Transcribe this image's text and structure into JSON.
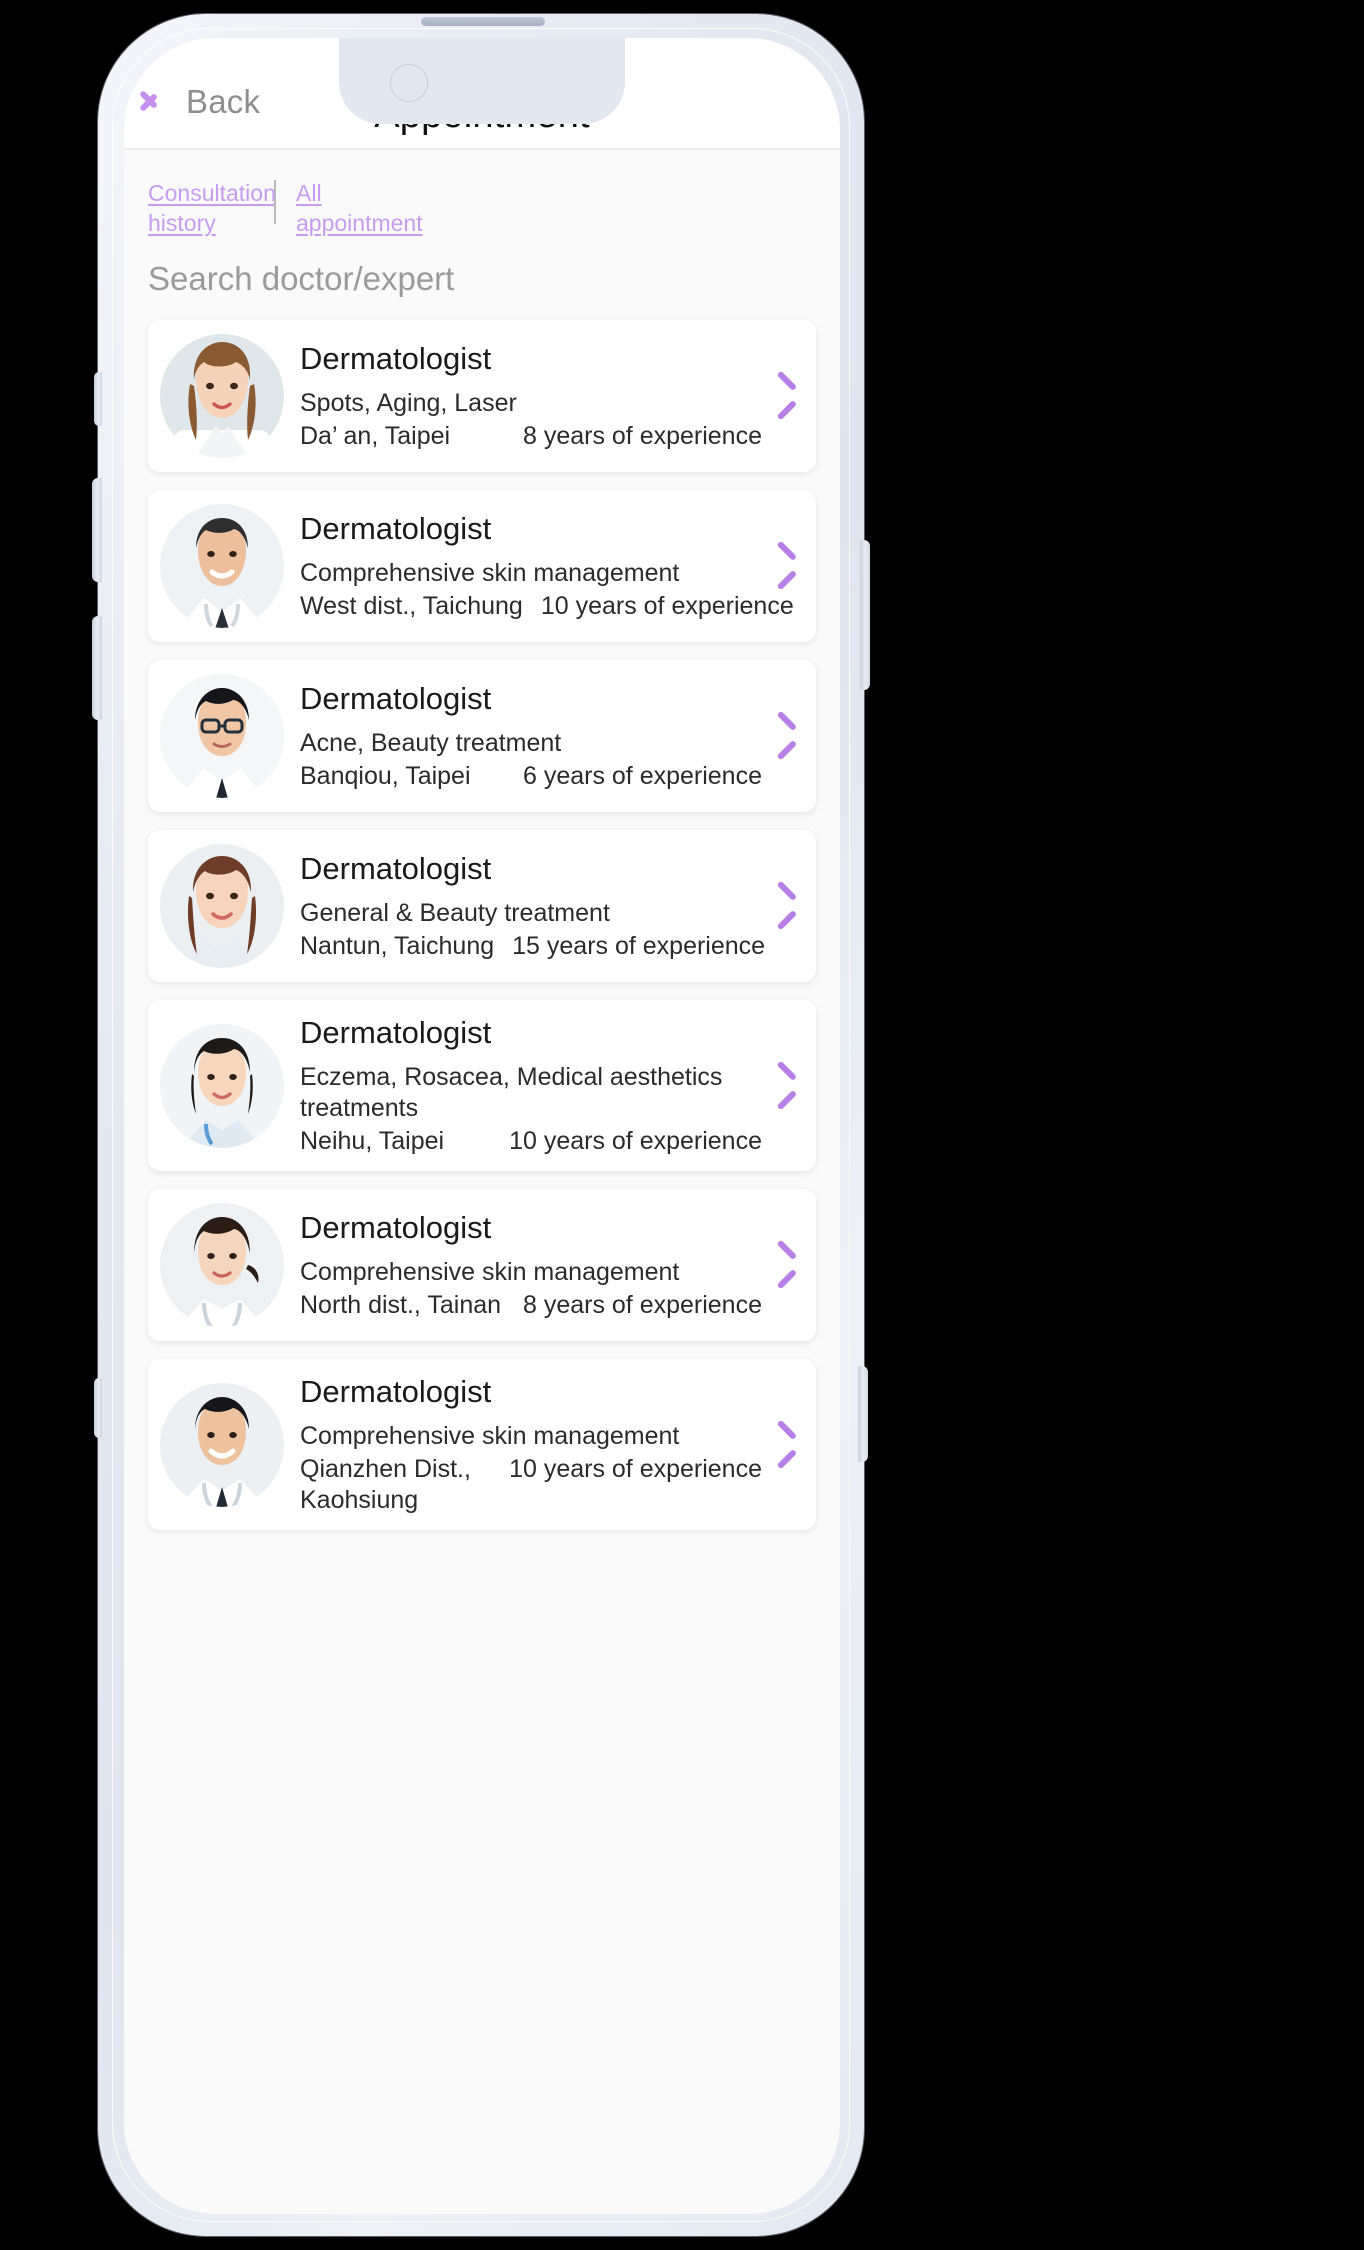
{
  "nav": {
    "back_label": "Back",
    "title": "Appointment",
    "back_icon": "chevron-left-icon"
  },
  "tabs": [
    {
      "label": "Consultation history"
    },
    {
      "label": "All appointment"
    }
  ],
  "search": {
    "placeholder": "Search doctor/expert",
    "value": ""
  },
  "colors": {
    "accent": "#c79cf0",
    "chevron": "#b97fe8",
    "screen_bg": "#fafafa",
    "card_bg": "#ffffff",
    "text": "#1a1a1a",
    "muted": "#8e8e8e"
  },
  "doctors": [
    {
      "title": "Dermatologist",
      "specialty": "Spots, Aging, Laser",
      "location": "Da’ an, Taipei",
      "experience": "8 years of experience",
      "avatar": "female-doctor-long-hair",
      "wrap": false
    },
    {
      "title": "Dermatologist",
      "specialty": "Comprehensive skin management",
      "location": "West dist., Taichung",
      "experience": "10 years of experience",
      "avatar": "male-doctor-stethoscope",
      "wrap": false
    },
    {
      "title": "Dermatologist",
      "specialty": "Acne, Beauty treatment",
      "location": "Banqiou, Taipei",
      "experience": "6 years of experience",
      "avatar": "male-doctor-glasses",
      "wrap": false
    },
    {
      "title": "Dermatologist",
      "specialty": "General & Beauty treatment",
      "location": "Nantun, Taichung",
      "experience": "15 years of experience",
      "avatar": "female-doctor-brown-hair",
      "wrap": false
    },
    {
      "title": "Dermatologist",
      "specialty": "Eczema, Rosacea, Medical aesthetics treatments",
      "location": "Neihu, Taipei",
      "experience": "10 years of experience",
      "avatar": "female-doctor-short-hair",
      "wrap": false
    },
    {
      "title": "Dermatologist",
      "specialty": "Comprehensive skin management",
      "location": "North dist., Tainan",
      "experience": "8  years of experience",
      "avatar": "female-doctor-ponytail",
      "wrap": false
    },
    {
      "title": "Dermatologist",
      "specialty": "Comprehensive skin management",
      "location": "Qianzhen Dist., Kaohsiung",
      "experience": "10 years of experience",
      "avatar": "male-doctor-smiling",
      "wrap": true
    }
  ]
}
